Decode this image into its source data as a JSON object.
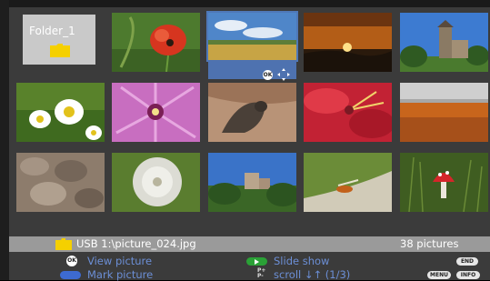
{
  "grid": {
    "folder_label": "Folder_1"
  },
  "status": {
    "path": "USB 1:\\picture_024.jpg",
    "count": "38 pictures"
  },
  "help": {
    "ok_key": "OK",
    "view_picture": "View picture",
    "mark_picture": "Mark picture",
    "slide_show": "Slide show",
    "pp_key": "P+\nP-",
    "scroll": "scroll ↓↑ (1/3)",
    "end_key": "END",
    "menu_key": "MENU",
    "info_key": "INFO"
  },
  "colors": {
    "background": "#3b3b3b",
    "selection": "#4e72b0",
    "help_text": "#6c8fd6",
    "status_bar": "#9a9a9a",
    "folder_yellow": "#f5d000"
  },
  "icons": [
    "folder-icon",
    "ok-button-icon",
    "move-arrows-icon",
    "blue-key-icon",
    "green-play-key-icon"
  ]
}
